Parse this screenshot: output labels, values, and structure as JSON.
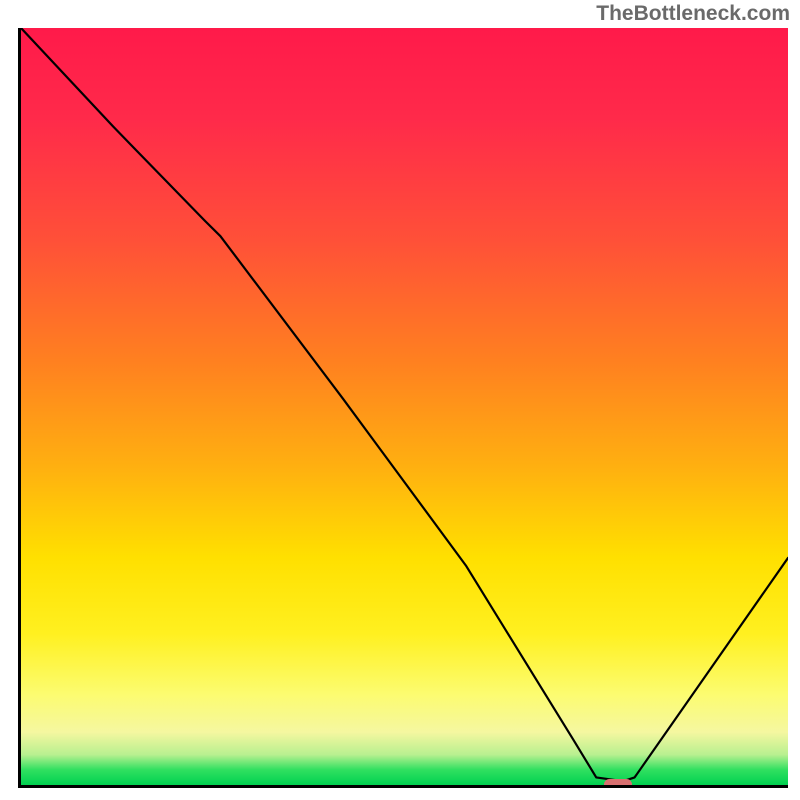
{
  "watermark": "TheBottleneck.com",
  "chart_data": {
    "type": "line",
    "title": "",
    "xlabel": "",
    "ylabel": "",
    "xlim": [
      0,
      100
    ],
    "ylim": [
      0,
      100
    ],
    "grid": false,
    "legend": false,
    "background": {
      "type": "vertical-gradient",
      "description": "red-to-green heat gradient (top=bad, bottom=good)",
      "stops": [
        {
          "pct": 0,
          "color": "#ff1a4a"
        },
        {
          "pct": 28,
          "color": "#ff5038"
        },
        {
          "pct": 58,
          "color": "#ffb010"
        },
        {
          "pct": 80,
          "color": "#fff020"
        },
        {
          "pct": 96,
          "color": "#b8f090"
        },
        {
          "pct": 100,
          "color": "#00d050"
        }
      ]
    },
    "series": [
      {
        "name": "bottleneck-curve",
        "x": [
          0.0,
          12.0,
          24.0,
          26.0,
          42.0,
          58.0,
          72.0,
          75.0,
          78.5,
          80.0,
          100.0
        ],
        "values": [
          100.0,
          87.0,
          74.5,
          72.5,
          51.0,
          29.0,
          6.0,
          1.0,
          0.5,
          1.0,
          30.0
        ]
      }
    ],
    "marker": {
      "name": "optimal-point",
      "x": 77.5,
      "y": 0.5,
      "color": "#d87070"
    }
  }
}
